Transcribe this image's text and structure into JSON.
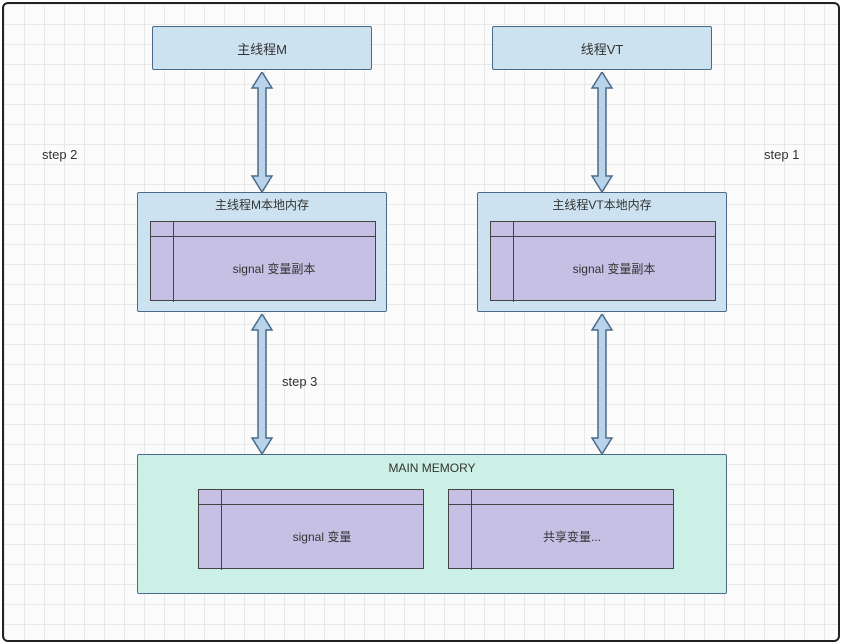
{
  "diagram": {
    "mainThread": {
      "label": "主线程M"
    },
    "threadVT": {
      "label": "线程VT"
    },
    "mainLocalMem": {
      "title": "主线程M本地内存",
      "cell": "signal 变量副本"
    },
    "vtLocalMem": {
      "title": "主线程VT本地内存",
      "cell": "signal 变量副本"
    },
    "mainMemory": {
      "title": "MAIN MEMORY",
      "cell1": "signal 变量",
      "cell2": "共享变量..."
    },
    "steps": {
      "s1": "step 1",
      "s2": "step 2",
      "s3": "step 3"
    }
  },
  "colors": {
    "lightblue": "#cde2f0",
    "lavender": "#c5c0e4",
    "mint": "#ccf0e5",
    "arrowFill": "#b9d4ea",
    "arrowStroke": "#4a6a8a"
  }
}
